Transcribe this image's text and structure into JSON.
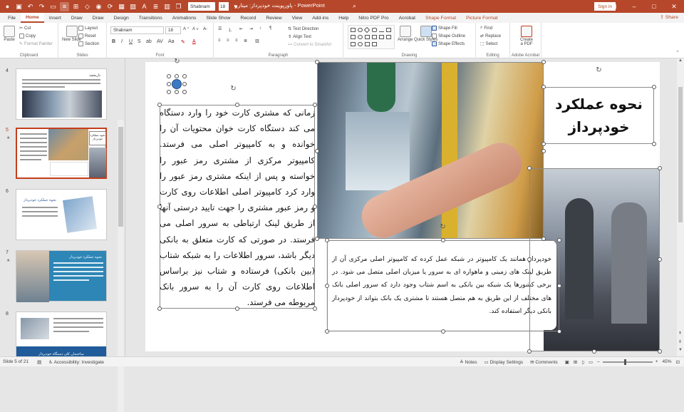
{
  "titlebar": {
    "font_name": "Shabnam",
    "font_size": "18",
    "document_title": "پاورپوینت خودپرداز: میتارو",
    "app_name": "PowerPoint",
    "sign_in": "Sign in"
  },
  "tabs": [
    "File",
    "Home",
    "Insert",
    "Draw",
    "Draw",
    "Design",
    "Transitions",
    "Animations",
    "Slide Show",
    "Record",
    "Review",
    "View",
    "Add-ins",
    "Help",
    "Nitro PDF Pro",
    "Acrobat",
    "Shape Format",
    "Picture Format"
  ],
  "active_tab": "Home",
  "share_label": "Share",
  "ribbon": {
    "clipboard": {
      "paste": "Paste",
      "cut": "Cut",
      "copy": "Copy",
      "format_painter": "Format Painter",
      "label": "Clipboard"
    },
    "slides": {
      "new_slide": "New Slide",
      "layout": "Layout",
      "reset": "Reset",
      "section": "Section",
      "label": "Slides"
    },
    "font": {
      "name": "Shabnam",
      "size": "18",
      "label": "Font"
    },
    "paragraph": {
      "text_direction": "Text Direction",
      "align_text": "Align Text",
      "convert_smartart": "Convert to SmartArt",
      "label": "Paragraph"
    },
    "drawing": {
      "arrange": "Arrange",
      "quick_styles": "Quick Styles",
      "shape_fill": "Shape Fill",
      "shape_outline": "Shape Outline",
      "shape_effects": "Shape Effects",
      "label": "Drawing"
    },
    "editing": {
      "find": "Find",
      "replace": "Replace",
      "select": "Select",
      "label": "Editing"
    },
    "acrobat": {
      "create_pdf": "Create a PDF",
      "label": "Adobe Acrobat"
    }
  },
  "thumbnails": [
    {
      "number": "4",
      "title": "تاریخچه"
    },
    {
      "number": "5",
      "title": "نحوه عملکرد خودپرداز"
    },
    {
      "number": "6",
      "title": "نحوه عملکرد خودپرداز"
    },
    {
      "number": "7",
      "title": "نحوه عملکرد خودپرداز"
    },
    {
      "number": "8",
      "title": "ساختمان کلی دستگاه خودپرداز"
    }
  ],
  "slide": {
    "title_line1": "نحوه عملکرد",
    "title_line2": "خودپرداز",
    "left_text": "زمانی که مشتری کارت خود را وارد دستگاه می کند دستگاه کارت خوان محتویات آن را خوانده و به کامپیوتر اصلی می فرستد. کامپیوتر مرکزی از مشتری رمز عبور را خواسته و پس از اینکه مشتری رمز عبور را وارد کرد کامپیوتر اصلی اطلاعات روی کارت و رمز عبور مشتری را جهت تایید درستی آنها از طریق لینک ارتباطی به سرور اصلی می فرستد. در صورتی که کارت متعلق به بانکی دیگر باشد، سرور اطلاعات را به شبکه شتاب (بین بانکی) فرستاده و شتاب نیز براساس اطلاعات روی کارت آن را به سرور بانک مربوطه می فرستد.",
    "bottom_text": "خودپرداز همانند یک کامپیوتر در شبکه عمل کرده که کامپیوتر اصلی مرکزی آن از طریق لینک های زمینی و ماهواره ای به سرور یا میزبان اصلی متصل می شود. در برخی کشورها یک شبکه بین بانکی به اسم شتاب وجود دارد که سرور اصلی بانک های مختلف از این طریق به هم متصل هستند تا مشتری یک بانک بتواند از خودپرداز بانکی دیگر استفاده کند."
  },
  "status": {
    "slide_info": "Slide 5 of 21",
    "accessibility": "Accessibility: Investigate",
    "notes": "Notes",
    "display_settings": "Display Settings",
    "comments": "Comments",
    "zoom": "45%"
  },
  "colors": {
    "accent": "#b7472a",
    "selected_thumb": "#c43e1c"
  }
}
